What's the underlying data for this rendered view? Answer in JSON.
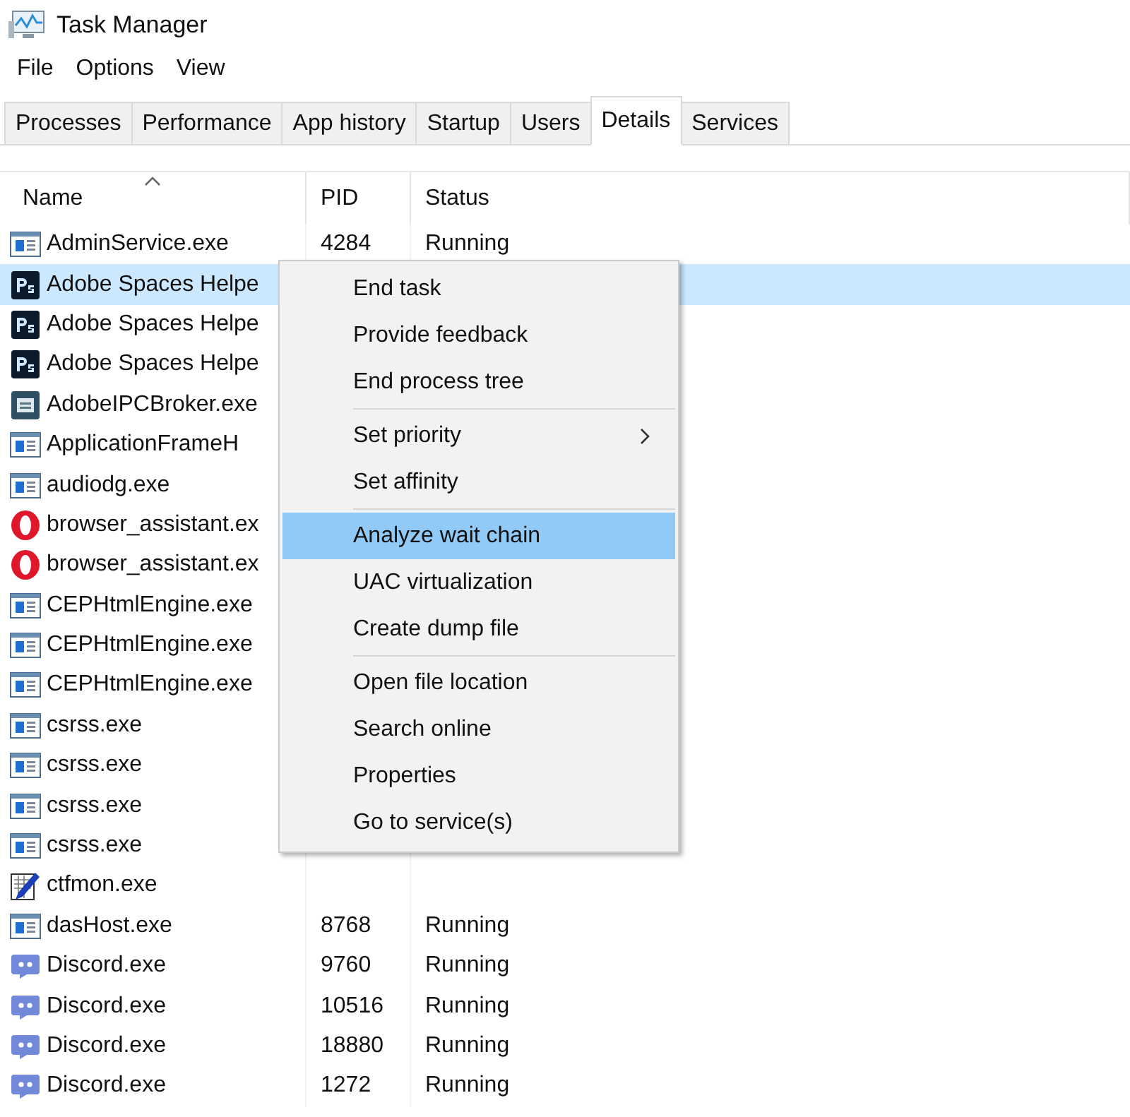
{
  "window": {
    "title": "Task Manager"
  },
  "menu_bar": [
    "File",
    "Options",
    "View"
  ],
  "tabs": [
    {
      "label": "Processes",
      "selected": false
    },
    {
      "label": "Performance",
      "selected": false
    },
    {
      "label": "App history",
      "selected": false
    },
    {
      "label": "Startup",
      "selected": false
    },
    {
      "label": "Users",
      "selected": false
    },
    {
      "label": "Details",
      "selected": true
    },
    {
      "label": "Services",
      "selected": false
    }
  ],
  "table": {
    "columns": [
      {
        "label": "Name",
        "sorted": true
      },
      {
        "label": "PID",
        "sorted": false
      },
      {
        "label": "Status",
        "sorted": false
      }
    ],
    "rows": [
      {
        "kind": "app",
        "name": "AdminService.exe",
        "pid": "4284",
        "status": "Running",
        "selected": false
      },
      {
        "kind": "ps",
        "name": "Adobe Spaces Helpe",
        "selected": true
      },
      {
        "kind": "ps",
        "name": "Adobe Spaces Helpe",
        "selected": false
      },
      {
        "kind": "ps",
        "name": "Adobe Spaces Helpe",
        "selected": false
      },
      {
        "kind": "broker",
        "name": "AdobeIPCBroker.exe",
        "selected": false
      },
      {
        "kind": "app",
        "name": "ApplicationFrameH",
        "selected": false
      },
      {
        "kind": "app",
        "name": "audiodg.exe",
        "selected": false
      },
      {
        "kind": "opera",
        "name": "browser_assistant.ex",
        "selected": false
      },
      {
        "kind": "opera",
        "name": "browser_assistant.ex",
        "selected": false
      },
      {
        "kind": "app",
        "name": "CEPHtmlEngine.exe",
        "selected": false
      },
      {
        "kind": "app",
        "name": "CEPHtmlEngine.exe",
        "selected": false
      },
      {
        "kind": "app",
        "name": "CEPHtmlEngine.exe",
        "selected": false
      },
      {
        "kind": "app",
        "name": "csrss.exe",
        "selected": false
      },
      {
        "kind": "app",
        "name": "csrss.exe",
        "selected": false
      },
      {
        "kind": "app",
        "name": "csrss.exe",
        "selected": false
      },
      {
        "kind": "app",
        "name": "csrss.exe",
        "selected": false
      },
      {
        "kind": "notepad",
        "name": "ctfmon.exe",
        "selected": false
      },
      {
        "kind": "app",
        "name": "dasHost.exe",
        "pid": "8768",
        "status": "Running",
        "selected": false
      },
      {
        "kind": "discord",
        "name": "Discord.exe",
        "pid": "9760",
        "status": "Running",
        "selected": false
      },
      {
        "kind": "discord",
        "name": "Discord.exe",
        "pid": "10516",
        "status": "Running",
        "selected": false
      },
      {
        "kind": "discord",
        "name": "Discord.exe",
        "pid": "18880",
        "status": "Running",
        "selected": false
      },
      {
        "kind": "discord",
        "name": "Discord.exe",
        "pid": "1272",
        "status": "Running",
        "selected": false
      }
    ]
  },
  "context_menu": {
    "items": [
      {
        "label": "End task",
        "selected": false,
        "submenu": false,
        "separator_after": false
      },
      {
        "label": "Provide feedback",
        "selected": false,
        "submenu": false,
        "separator_after": false
      },
      {
        "label": "End process tree",
        "selected": false,
        "submenu": false,
        "separator_after": true
      },
      {
        "label": "Set priority",
        "selected": false,
        "submenu": true,
        "separator_after": false
      },
      {
        "label": "Set affinity",
        "selected": false,
        "submenu": false,
        "separator_after": true
      },
      {
        "label": "Analyze wait chain",
        "selected": true,
        "submenu": false,
        "separator_after": false
      },
      {
        "label": "UAC virtualization",
        "selected": false,
        "submenu": false,
        "separator_after": false
      },
      {
        "label": "Create dump file",
        "selected": false,
        "submenu": false,
        "separator_after": true
      },
      {
        "label": "Open file location",
        "selected": false,
        "submenu": false,
        "separator_after": false
      },
      {
        "label": "Search online",
        "selected": false,
        "submenu": false,
        "separator_after": false
      },
      {
        "label": "Properties",
        "selected": false,
        "submenu": false,
        "separator_after": false
      },
      {
        "label": "Go to service(s)",
        "selected": false,
        "submenu": false,
        "separator_after": false
      }
    ]
  }
}
